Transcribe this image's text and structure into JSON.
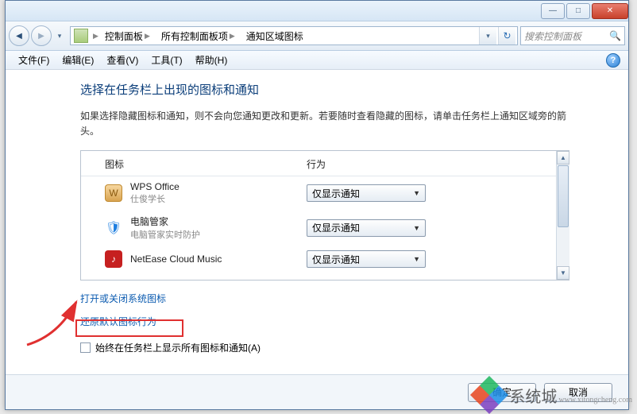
{
  "window": {
    "controls": {
      "min": "—",
      "max": "□",
      "close": "✕"
    }
  },
  "nav": {
    "breadcrumbs": [
      "控制面板",
      "所有控制面板项",
      "通知区域图标"
    ],
    "search_placeholder": "搜索控制面板"
  },
  "menu": {
    "file": "文件(F)",
    "edit": "编辑(E)",
    "view": "查看(V)",
    "tools": "工具(T)",
    "help": "帮助(H)"
  },
  "page": {
    "title": "选择在任务栏上出现的图标和通知",
    "description": "如果选择隐藏图标和通知，则不会向您通知更改和更新。若要随时查看隐藏的图标，请单击任务栏上通知区域旁的箭头。",
    "col_icon": "图标",
    "col_behavior": "行为",
    "rows": [
      {
        "title": "WPS Office",
        "sub": "仕俊学长",
        "value": "仅显示通知"
      },
      {
        "title": "电脑管家",
        "sub": "电脑管家实时防护",
        "value": "仅显示通知"
      },
      {
        "title": "NetEase Cloud Music",
        "sub": "",
        "value": "仅显示通知"
      }
    ],
    "link_system_icons": "打开或关闭系统图标",
    "link_restore": "还原默认图标行为",
    "checkbox_label": "始终在任务栏上显示所有图标和通知(A)"
  },
  "footer": {
    "ok": "确定",
    "cancel": "取消"
  },
  "watermark": {
    "text": "系统城",
    "sub": "www.xitongcheng.com"
  }
}
